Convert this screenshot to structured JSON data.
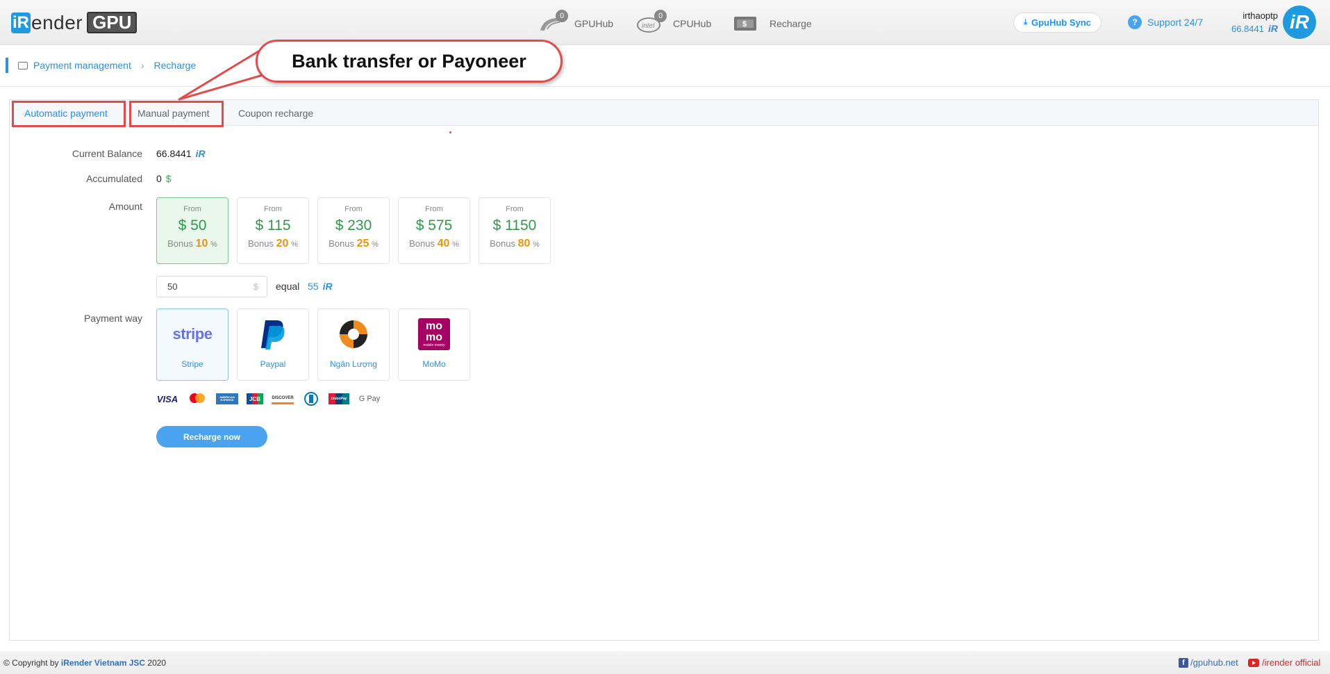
{
  "header": {
    "logo_prefix": "iR",
    "logo_suffix": "ender",
    "logo_badge": "GPU",
    "nav": [
      {
        "label": "GPUHub",
        "count": "0",
        "icon": "gpu-card-icon"
      },
      {
        "label": "CPUHub",
        "count": "0",
        "icon": "intel-chip-icon"
      },
      {
        "label": "Recharge",
        "icon": "money-icon"
      }
    ],
    "sync_label": "GpuHub Sync",
    "support_label": "Support 24/7",
    "username": "irthaoptp",
    "balance": "66.8441",
    "coin_symbol": "iR"
  },
  "breadcrumb": {
    "root": "Payment management",
    "current": "Recharge"
  },
  "callout": {
    "text": "Bank transfer or Payoneer"
  },
  "tabs": [
    {
      "label": "Automatic payment",
      "active": true
    },
    {
      "label": "Manual payment",
      "active": false
    },
    {
      "label": "Coupon recharge",
      "active": false
    }
  ],
  "form": {
    "current_balance_label": "Current Balance",
    "current_balance_value": "66.8441",
    "accumulated_label": "Accumulated",
    "accumulated_value": "0",
    "accumulated_currency": "$",
    "amount_label": "Amount",
    "amount_options": [
      {
        "from": "From",
        "price": "$ 50",
        "bonus_label": "Bonus",
        "bonus": "10",
        "pct": "%",
        "selected": true
      },
      {
        "from": "From",
        "price": "$ 115",
        "bonus_label": "Bonus",
        "bonus": "20",
        "pct": "%",
        "selected": false
      },
      {
        "from": "From",
        "price": "$ 230",
        "bonus_label": "Bonus",
        "bonus": "25",
        "pct": "%",
        "selected": false
      },
      {
        "from": "From",
        "price": "$ 575",
        "bonus_label": "Bonus",
        "bonus": "40",
        "pct": "%",
        "selected": false
      },
      {
        "from": "From",
        "price": "$ 1150",
        "bonus_label": "Bonus",
        "bonus": "80",
        "pct": "%",
        "selected": false
      }
    ],
    "amount_input_value": "50",
    "amount_input_currency": "$",
    "equal_label": "equal",
    "equal_value": "55",
    "payment_way_label": "Payment way",
    "payment_methods": [
      {
        "name": "Stripe",
        "logo": "stripe",
        "selected": true
      },
      {
        "name": "Paypal",
        "logo": "paypal-icon",
        "selected": false
      },
      {
        "name": "Ngân Lượng",
        "logo": "nganluong-icon",
        "selected": false
      },
      {
        "name": "MoMo",
        "logo_top": "mo",
        "logo_bottom": "mo",
        "logo_caption": "mobile money",
        "selected": false
      }
    ],
    "card_brands": [
      "VISA",
      "mastercard",
      "AMERICAN EXPRESS",
      "JCB",
      "DISCOVER",
      "Diners Club",
      "UnionPay",
      "G Pay"
    ],
    "submit_label": "Recharge now"
  },
  "footer": {
    "copyright_prefix": "© Copyright by",
    "company": "iRender Vietnam JSC",
    "year": "2020",
    "facebook": "/gpuhub.net",
    "youtube": "/irender official"
  },
  "colors": {
    "accent": "#2f8fe0",
    "price_green": "#2d9a45",
    "bonus_orange": "#f0930a",
    "highlight_red": "#e34b4b"
  }
}
